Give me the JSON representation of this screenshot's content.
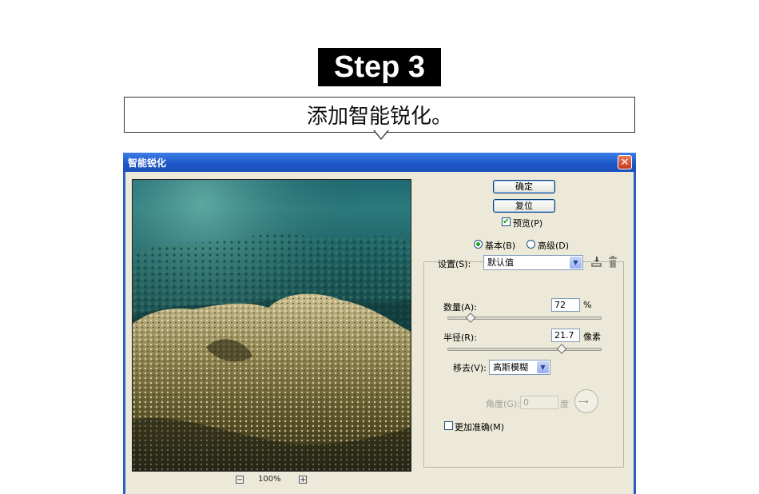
{
  "step": {
    "label": "Step 3"
  },
  "caption": {
    "text": "添加智能锐化。"
  },
  "dialog": {
    "title": "智能锐化",
    "close_label": "✕",
    "buttons": {
      "ok": "确定",
      "reset": "复位"
    },
    "preview_checkbox": {
      "label": "预览(P)",
      "checked": true
    },
    "mode": {
      "basic": "基本(B)",
      "advanced": "高级(D)",
      "selected": "basic"
    },
    "settings": {
      "label": "设置(S):",
      "value": "默认值"
    },
    "amount": {
      "label": "数量(A):",
      "value": "72",
      "unit": "%",
      "slider_fraction": 0.15
    },
    "radius": {
      "label": "半径(R):",
      "value": "21.7",
      "unit": "像素",
      "slider_fraction": 0.74
    },
    "remove": {
      "label": "移去(V):",
      "value": "高斯模糊"
    },
    "angle": {
      "label": "角度(G):",
      "value": "0",
      "unit": "度"
    },
    "more_accurate": {
      "label": "更加准确(M)",
      "checked": false
    },
    "zoom": {
      "value": "100%",
      "minus": "−",
      "plus": "+"
    }
  },
  "colors": {
    "titlebar": "#1d56c6",
    "dialog_bg": "#ece9d8",
    "accent_green": "#21a121"
  },
  "icons": {
    "save_preset": "save-preset-icon",
    "delete_preset": "trash-icon",
    "close": "close-icon"
  }
}
